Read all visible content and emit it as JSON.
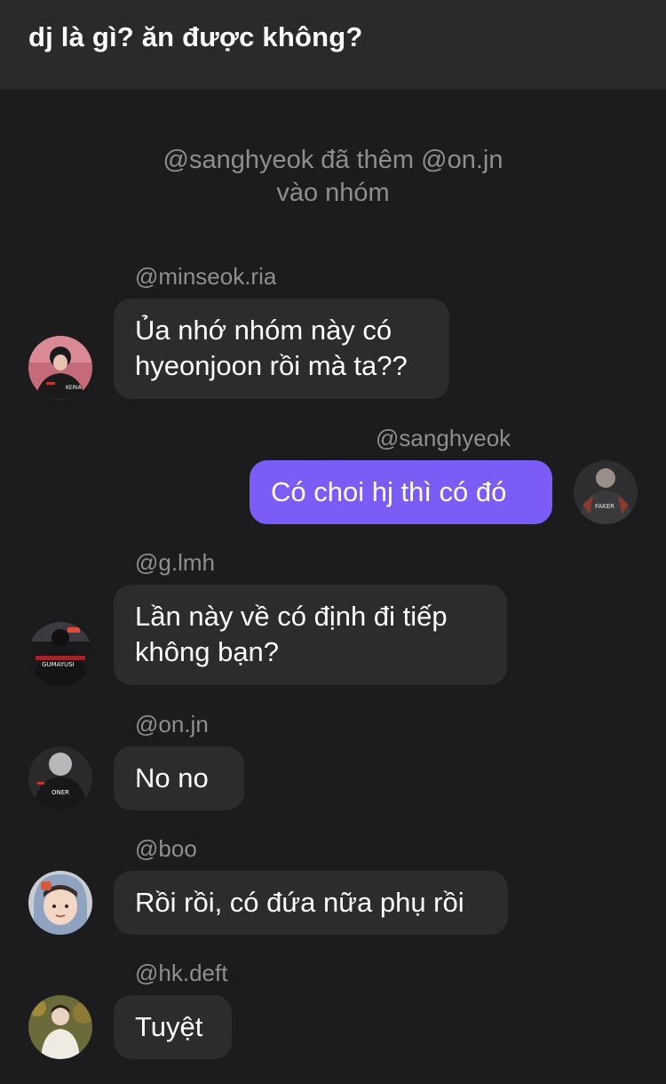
{
  "theme": {
    "background": "#1c1c1e",
    "header_bg": "#2a2a2c",
    "bubble_in": "#2c2c2e",
    "bubble_out": "#7c5cf6",
    "muted_text": "#8e8e93"
  },
  "header": {
    "title": "dj là gì? ăn được không?"
  },
  "system_message": {
    "line1": "@sanghyeok đã thêm @on.jn",
    "line2": "vào nhóm"
  },
  "messages": [
    {
      "user": "@minseok.ria",
      "lines": [
        "Ủa nhớ nhóm này có",
        "hyeonjoon rồi mà ta??"
      ],
      "avatar_text": "KERIA"
    },
    {
      "user": "@sanghyeok",
      "lines": [
        "Có choi hj thì có đó"
      ],
      "avatar_text": "FAKER"
    },
    {
      "user": "@g.lmh",
      "lines": [
        "Lần này về có định đi tiếp",
        "không bạn?"
      ],
      "avatar_text": "GUMAYUSI"
    },
    {
      "user": "@on.jn",
      "lines": [
        "No no"
      ],
      "avatar_text": "ONER"
    },
    {
      "user": "@boo",
      "lines": [
        "Rồi rồi, có đứa nữa phụ rồi"
      ],
      "avatar_text": ""
    },
    {
      "user": "@hk.deft",
      "lines": [
        "Tuyệt"
      ],
      "avatar_text": ""
    }
  ]
}
